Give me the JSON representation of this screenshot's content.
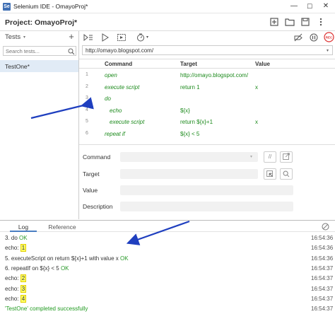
{
  "window": {
    "title": "Selenium IDE - OmayoProj*",
    "min": "—",
    "max": "☐",
    "close": "✕"
  },
  "project": {
    "title": "Project:  OmayoProj*"
  },
  "sidebar": {
    "tests_label": "Tests",
    "caret": "▾",
    "add": "+",
    "search_placeholder": "Search tests...",
    "tests": [
      {
        "label": "TestOne*"
      }
    ]
  },
  "toolbar": {
    "speed_caret": "▾"
  },
  "url": {
    "value": "http://omayo.blogspot.com/",
    "caret": "▾"
  },
  "grid": {
    "headers": {
      "command": "Command",
      "target": "Target",
      "value": "Value"
    },
    "rows": [
      {
        "num": "1",
        "command": "open",
        "target": "http://omayo.blogspot.com/",
        "value": ""
      },
      {
        "num": "2",
        "command": "execute script",
        "target": "return 1",
        "value": "x"
      },
      {
        "num": "3",
        "command": "do",
        "target": "",
        "value": ""
      },
      {
        "num": "4",
        "command": "echo",
        "target": "${x}",
        "value": ""
      },
      {
        "num": "5",
        "command": "execute script",
        "target": "return ${x}+1",
        "value": "x"
      },
      {
        "num": "6",
        "command": "repeat if",
        "target": "${x} < 5",
        "value": ""
      }
    ]
  },
  "form": {
    "command": "Command",
    "target": "Target",
    "value": "Value",
    "description": "Description",
    "comment_btn": "//"
  },
  "log": {
    "tabs": {
      "log": "Log",
      "reference": "Reference"
    },
    "lines": [
      {
        "pre": "3.  do ",
        "ok": "OK",
        "time": "16:54:36"
      },
      {
        "pre": "echo: ",
        "hl": "1",
        "time": "16:54:36"
      },
      {
        "pre": "5.  executeScript on return ${x}+1 with value x ",
        "ok": "OK",
        "time": "16:54:36"
      },
      {
        "pre": "6.  repeatIf on ${x} < 5 ",
        "ok": "OK",
        "time": "16:54:37"
      },
      {
        "pre": "echo: ",
        "hl": "2",
        "time": "16:54:37"
      },
      {
        "pre": "echo: ",
        "hl": "3",
        "time": "16:54:37"
      },
      {
        "pre": "echo: ",
        "hl": "4",
        "time": "16:54:37"
      },
      {
        "done": "'TestOne' completed successfully",
        "time": "16:54:37"
      }
    ]
  },
  "colors": {
    "accent": "#4a7fc1",
    "command_green": "#1c8a1c",
    "highlight": "#ffff66",
    "arrow": "#1f3fbf"
  }
}
